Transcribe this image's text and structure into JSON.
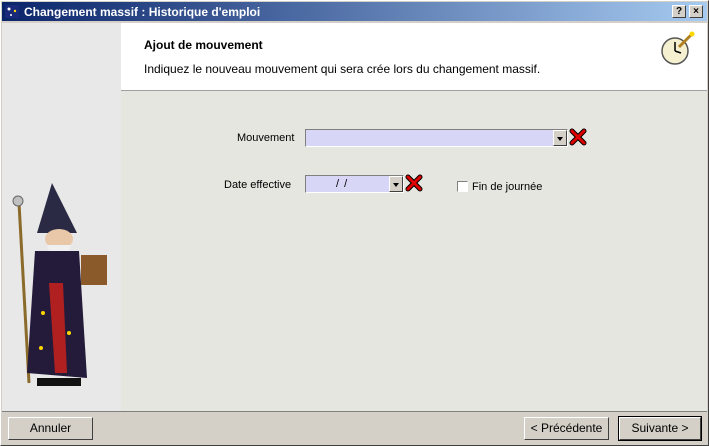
{
  "window": {
    "title": "Changement massif : Historique d'emploi",
    "help_button": "?",
    "close_button": "×"
  },
  "header": {
    "title": "Ajout de mouvement",
    "description": "Indiquez le nouveau mouvement qui sera crée lors du changement massif."
  },
  "form": {
    "mouvement": {
      "label": "Mouvement",
      "value": ""
    },
    "date_effective": {
      "label": "Date effective",
      "value": "/   /"
    },
    "fin_de_journee": {
      "label": "Fin de journée",
      "checked": false
    }
  },
  "buttons": {
    "cancel": "Annuler",
    "previous": "< Précédente",
    "next": "Suivante >"
  },
  "colors": {
    "titlebar_start": "#0a246a",
    "titlebar_end": "#a6caf0",
    "input_bg": "#d8d6f6",
    "clear_red": "#e00000"
  },
  "icons": [
    "app-icon",
    "wizard-clock-icon",
    "clear-icon",
    "chevron-down-icon"
  ]
}
